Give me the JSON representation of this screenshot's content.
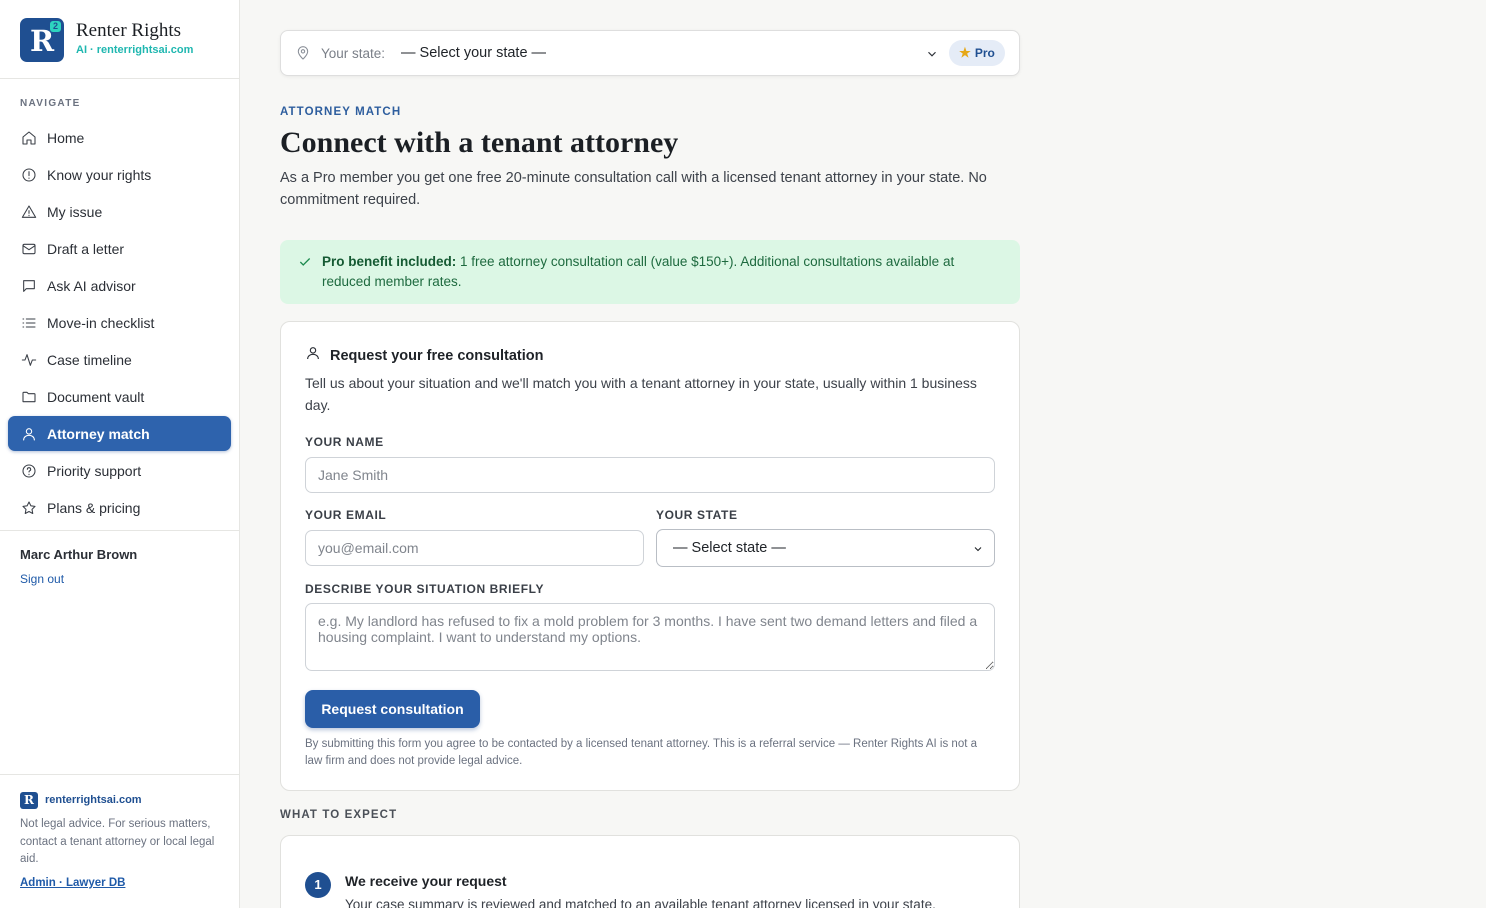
{
  "brand": {
    "name": "Renter Rights",
    "subtitle": "AI · renterrightsai.com",
    "logo_letter": "R",
    "logo_badge": "AI"
  },
  "nav": {
    "heading": "NAVIGATE",
    "items": [
      {
        "label": "Home",
        "icon": "home-icon"
      },
      {
        "label": "Know your rights",
        "icon": "info-circle-icon"
      },
      {
        "label": "My issue",
        "icon": "warning-triangle-icon"
      },
      {
        "label": "Draft a letter",
        "icon": "mail-icon"
      },
      {
        "label": "Ask AI advisor",
        "icon": "chat-icon"
      },
      {
        "label": "Move-in checklist",
        "icon": "list-icon"
      },
      {
        "label": "Case timeline",
        "icon": "activity-icon"
      },
      {
        "label": "Document vault",
        "icon": "folder-icon"
      },
      {
        "label": "Attorney match",
        "icon": "user-icon",
        "active": true
      },
      {
        "label": "Priority support",
        "icon": "help-circle-icon"
      },
      {
        "label": "Plans & pricing",
        "icon": "star-icon"
      }
    ]
  },
  "user": {
    "name": "Marc Arthur Brown",
    "signout": "Sign out"
  },
  "footer": {
    "site": "renterrightsai.com",
    "note": "Not legal advice. For serious matters, contact a tenant attorney or local legal aid.",
    "admin_link": "Admin · Lawyer DB"
  },
  "statebar": {
    "label": "Your state:",
    "value": "— Select your state —",
    "pro": "Pro"
  },
  "page": {
    "eyebrow": "ATTORNEY MATCH",
    "title": "Connect with a tenant attorney",
    "lead": "As a Pro member you get one free 20-minute consultation call with a licensed tenant attorney in your state. No commitment required."
  },
  "benefit": {
    "bold": "Pro benefit included:",
    "text": " 1 free attorney consultation call (value $150+). Additional consultations available at reduced member rates."
  },
  "form": {
    "heading": "Request your free consultation",
    "description": "Tell us about your situation and we'll match you with a tenant attorney in your state, usually within 1 business day.",
    "name_label": "YOUR NAME",
    "name_placeholder": "Jane Smith",
    "email_label": "YOUR EMAIL",
    "email_placeholder": "you@email.com",
    "state_label": "YOUR STATE",
    "state_value": "— Select state —",
    "situation_label": "DESCRIBE YOUR SITUATION BRIEFLY",
    "situation_placeholder": "e.g. My landlord has refused to fix a mold problem for 3 months. I have sent two demand letters and filed a housing complaint. I want to understand my options.",
    "submit": "Request consultation",
    "disclaimer": "By submitting this form you agree to be contacted by a licensed tenant attorney. This is a referral service — Renter Rights AI is not a law firm and does not provide legal advice."
  },
  "expect": {
    "heading": "WHAT TO EXPECT",
    "steps": [
      {
        "num": "1",
        "title": "We receive your request",
        "desc": "Your case summary is reviewed and matched to an available tenant attorney licensed in your state."
      }
    ]
  },
  "colors": {
    "accent": "#2e63ad",
    "brand_teal": "#1fb7b0",
    "success_bg": "#dcf7e5"
  }
}
